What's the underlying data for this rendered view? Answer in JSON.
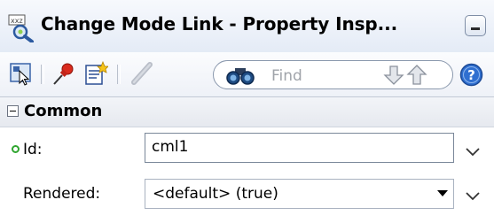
{
  "window": {
    "title": "Change Mode Link - Property Insp...",
    "app_icon": "property-inspector-icon",
    "minimize_icon": "minimize-icon"
  },
  "toolbar": {
    "buttons": [
      {
        "name": "select-node-icon"
      },
      {
        "name": "pin-icon"
      },
      {
        "name": "edit-properties-icon"
      },
      {
        "name": "pencil-icon"
      }
    ],
    "find": {
      "placeholder": "Find",
      "search_icon": "binoculars-icon",
      "prev_icon": "arrow-down-icon",
      "next_icon": "arrow-up-icon"
    },
    "help_icon": "help-icon"
  },
  "section": {
    "title": "Common",
    "expanded": true
  },
  "properties": [
    {
      "label": "Id:",
      "value": "cml1",
      "required": true,
      "type": "text"
    },
    {
      "label": "Rendered:",
      "value": "<default> (true)",
      "required": false,
      "type": "select"
    }
  ],
  "colors": {
    "required_dot": "#2fa52f",
    "titlebar_top": "#f7f9fd",
    "titlebar_bottom": "#e4ebf6"
  }
}
